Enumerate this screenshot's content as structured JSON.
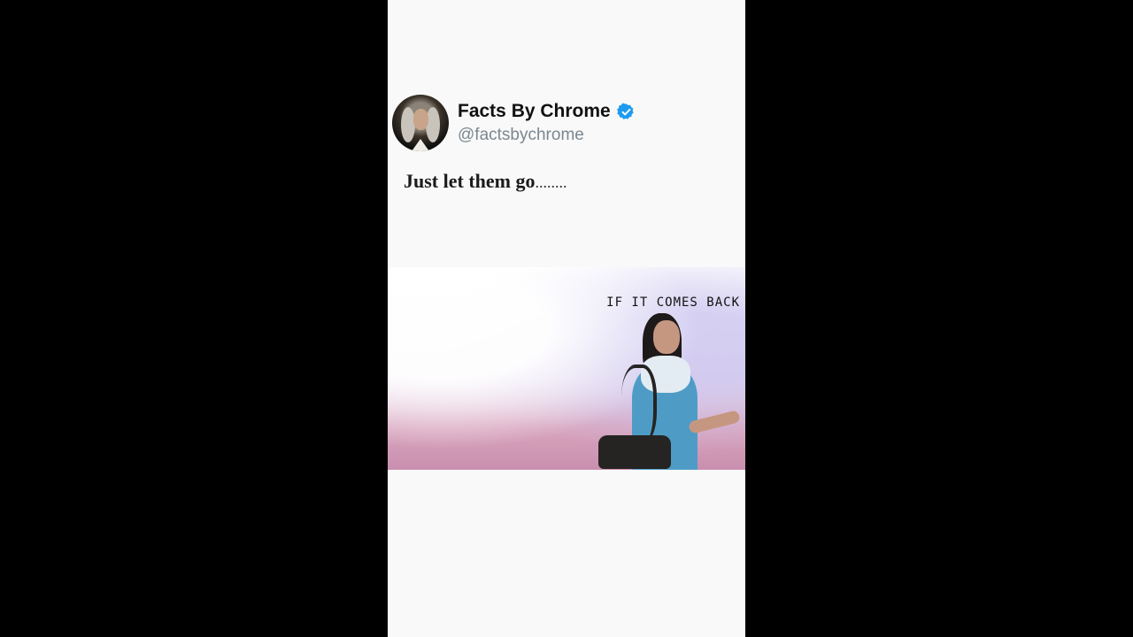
{
  "post": {
    "display_name": "Facts By Chrome",
    "handle": "@factsbychrome",
    "verified_icon": "verified-badge-icon",
    "text_main": "Just let them go",
    "text_dots": "........"
  },
  "media": {
    "caption": "IF IT COMES BACK"
  },
  "colors": {
    "background": "#000000",
    "panel": "#f8f9f8",
    "verified": "#1d9bf0",
    "handle": "#7c8791"
  }
}
